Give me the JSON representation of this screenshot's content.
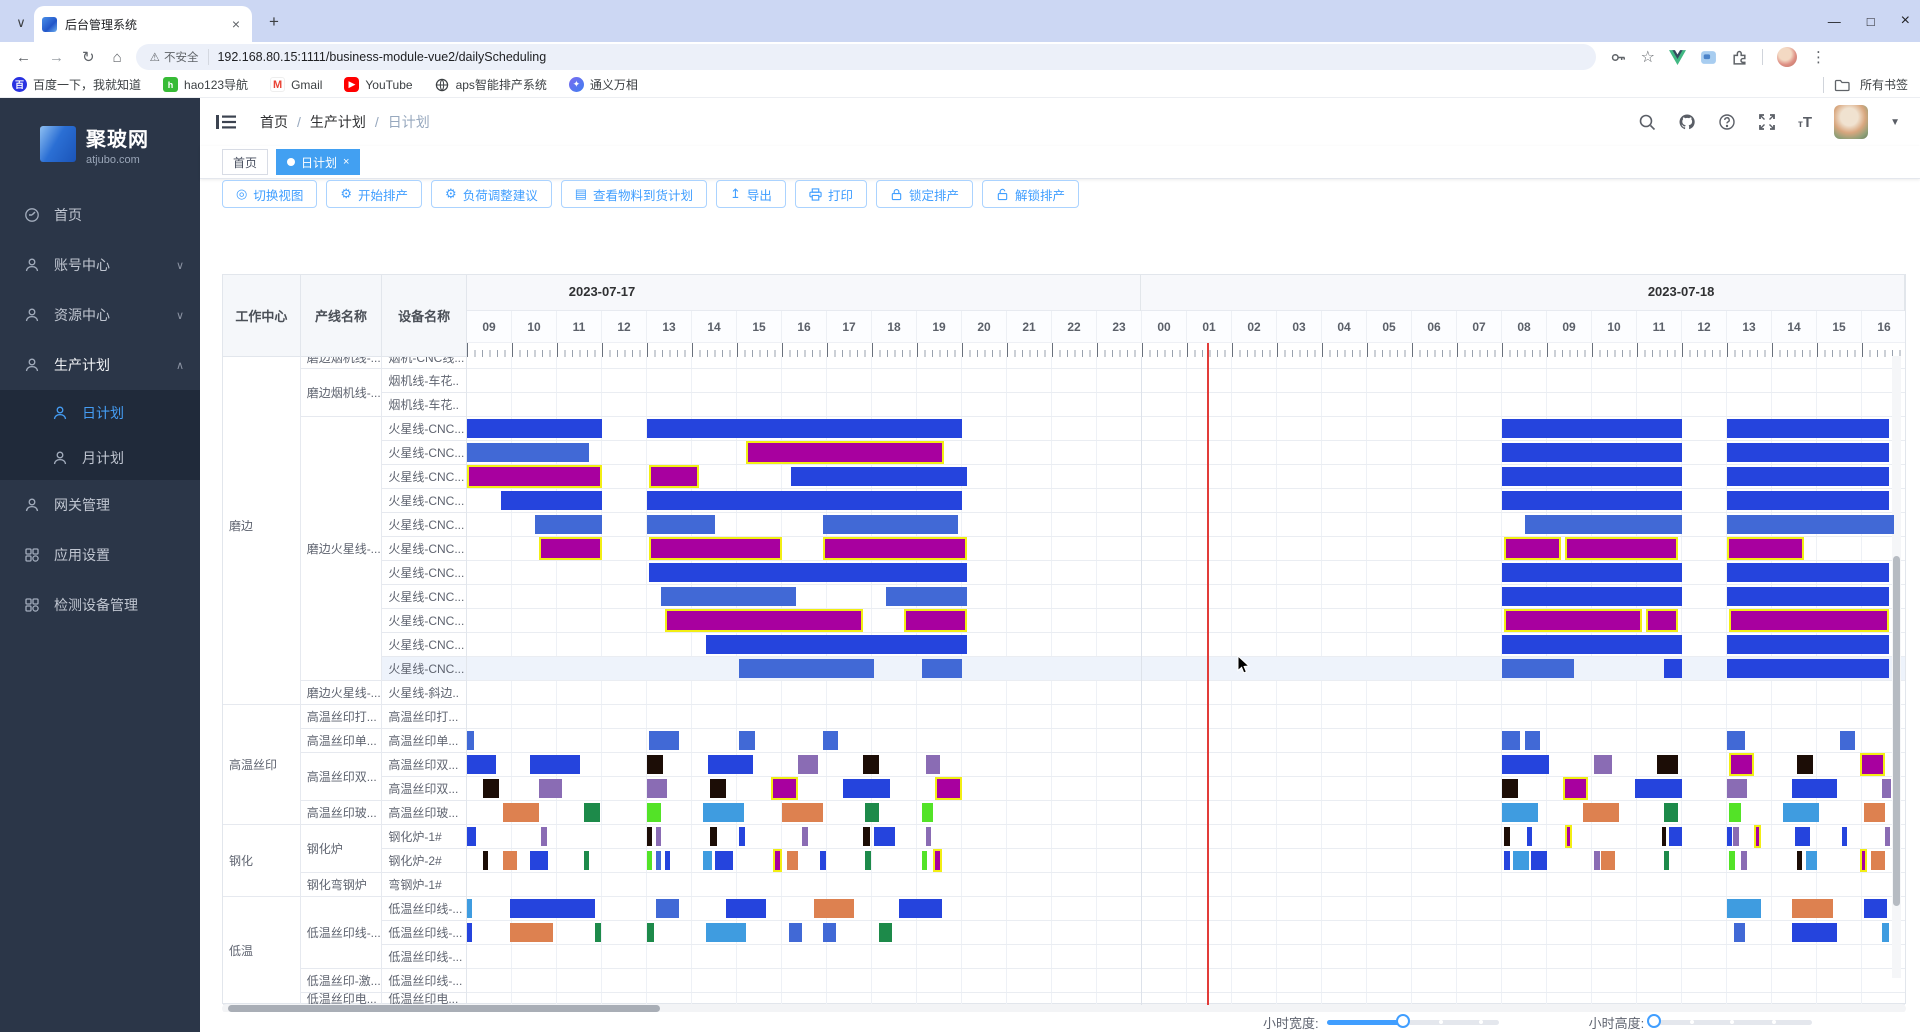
{
  "browser": {
    "tab_title": "后台管理系统",
    "security_label": "不安全",
    "url": "192.168.80.15:1111/business-module-vue2/dailyScheduling",
    "bookmarks": [
      "百度一下，我就知道",
      "hao123导航",
      "Gmail",
      "YouTube",
      "aps智能排产系统",
      "通义万相"
    ],
    "all_bookmarks_label": "所有书签",
    "window_controls": [
      "—",
      "□",
      "×"
    ],
    "new_tab_glyph": "+",
    "tab_close_glyph": "×",
    "tab_search_glyph": "∨",
    "nav_glyphs": {
      "back": "←",
      "forward": "→",
      "reload": "↻",
      "home": "⌂",
      "warning": "⚠"
    }
  },
  "sidebar": {
    "logo_title": "聚玻网",
    "logo_sub": "atjubo.com",
    "items": [
      {
        "label": "首页"
      },
      {
        "label": "账号中心",
        "arrow": "∨"
      },
      {
        "label": "资源中心",
        "arrow": "∨"
      },
      {
        "label": "生产计划",
        "arrow": "∧"
      },
      {
        "label": "日计划"
      },
      {
        "label": "月计划"
      },
      {
        "label": "网关管理"
      },
      {
        "label": "应用设置"
      },
      {
        "label": "检测设备管理"
      }
    ]
  },
  "header": {
    "breadcrumb": [
      "首页",
      "生产计划",
      "日计划"
    ],
    "separator": "/"
  },
  "tags": [
    {
      "label": "首页"
    },
    {
      "label": "日计划",
      "close_glyph": "×"
    }
  ],
  "toolbar": {
    "buttons": [
      "切换视图",
      "开始排产",
      "负荷调整建议",
      "查看物料到货计划",
      "导出",
      "打印",
      "锁定排产",
      "解锁排产"
    ]
  },
  "gantt": {
    "columns": [
      "工作中心",
      "产线名称",
      "设备名称"
    ],
    "dates": [
      "2023-07-17",
      "2023-07-18"
    ],
    "hours_day1": [
      "09",
      "10",
      "11",
      "12",
      "13",
      "14",
      "15",
      "16",
      "17",
      "18",
      "19",
      "20",
      "21",
      "22",
      "23"
    ],
    "hours_day2": [
      "00",
      "01",
      "02",
      "03",
      "04",
      "05",
      "06",
      "07",
      "08",
      "09",
      "10",
      "11",
      "12",
      "13",
      "14",
      "15",
      "16"
    ],
    "now_time_hour_offset": 16.45,
    "work_centers": [
      {
        "label": "磨边",
        "span": 15
      },
      {
        "label": "高温丝印",
        "span": 5
      },
      {
        "label": "钢化",
        "span": 3
      },
      {
        "label": "低温",
        "span": 5
      }
    ],
    "lines": [
      {
        "label": "磨边烟机线-...",
        "span": 1
      },
      {
        "label": "磨边烟机线-...",
        "span": 2
      },
      {
        "label": "磨边火星线-...",
        "span": 11
      },
      {
        "label": "磨边火星线-...",
        "span": 1
      },
      {
        "label": "高温丝印打...",
        "span": 1
      },
      {
        "label": "高温丝印单...",
        "span": 1
      },
      {
        "label": "高温丝印双...",
        "span": 2
      },
      {
        "label": "高温丝印玻...",
        "span": 1
      },
      {
        "label": "钢化炉",
        "span": 2
      },
      {
        "label": "钢化弯钢炉",
        "span": 1
      },
      {
        "label": "低温丝印线-...",
        "span": 3
      },
      {
        "label": "低温丝印-激...",
        "span": 1
      },
      {
        "label": "低温丝印电...",
        "span": 1
      }
    ],
    "rows": [
      {
        "device": "烟机-CNC线...",
        "bars": []
      },
      {
        "device": "烟机线-车花..",
        "bars": []
      },
      {
        "device": "烟机线-车花..",
        "bars": []
      },
      {
        "device": "火星线-CNC...",
        "bars": [
          [
            0,
            3,
            "b"
          ],
          [
            4,
            11,
            "b"
          ],
          [
            23,
            27,
            "b"
          ],
          [
            28,
            31.6,
            "b"
          ]
        ]
      },
      {
        "device": "火星线-CNC...",
        "bars": [
          [
            0,
            2.7,
            "m"
          ],
          [
            6.2,
            10.6,
            "p"
          ],
          [
            23,
            27,
            "b"
          ],
          [
            28,
            31.6,
            "b"
          ]
        ]
      },
      {
        "device": "火星线-CNC...",
        "bars": [
          [
            0,
            3,
            "p"
          ],
          [
            4.05,
            5.15,
            "p"
          ],
          [
            7.2,
            11.1,
            "b"
          ],
          [
            23,
            27,
            "b"
          ],
          [
            28,
            31.6,
            "b"
          ]
        ]
      },
      {
        "device": "火星线-CNC...",
        "bars": [
          [
            0.75,
            3,
            "b"
          ],
          [
            4,
            11,
            "b"
          ],
          [
            23,
            27,
            "b"
          ],
          [
            28,
            31.6,
            "b"
          ]
        ]
      },
      {
        "device": "火星线-CNC...",
        "bars": [
          [
            1.5,
            3,
            "m"
          ],
          [
            4,
            5.5,
            "m"
          ],
          [
            7.9,
            10.9,
            "m"
          ],
          [
            23.5,
            27,
            "m"
          ],
          [
            28,
            31.7,
            "m"
          ]
        ]
      },
      {
        "device": "火星线-CNC...",
        "bars": [
          [
            1.6,
            3,
            "p"
          ],
          [
            4.05,
            7,
            "p"
          ],
          [
            7.9,
            11.1,
            "p"
          ],
          [
            23.05,
            24.3,
            "p"
          ],
          [
            24.4,
            26.9,
            "p"
          ],
          [
            28,
            29.7,
            "p"
          ]
        ]
      },
      {
        "device": "火星线-CNC...",
        "bars": [
          [
            4.05,
            11.1,
            "b"
          ],
          [
            23,
            27,
            "b"
          ],
          [
            28,
            31.6,
            "b"
          ]
        ]
      },
      {
        "device": "火星线-CNC...",
        "bars": [
          [
            4.3,
            7.3,
            "m"
          ],
          [
            9.3,
            11.1,
            "m"
          ],
          [
            23,
            27,
            "b"
          ],
          [
            28,
            31.6,
            "b"
          ]
        ]
      },
      {
        "device": "火星线-CNC...",
        "bars": [
          [
            4.4,
            8.8,
            "p"
          ],
          [
            9.7,
            11.1,
            "p"
          ],
          [
            23.05,
            26.1,
            "p"
          ],
          [
            26.2,
            26.9,
            "p"
          ],
          [
            28.05,
            31.6,
            "p"
          ]
        ]
      },
      {
        "device": "火星线-CNC...",
        "bars": [
          [
            5.3,
            11.1,
            "b"
          ],
          [
            23,
            27,
            "b"
          ],
          [
            28,
            31.6,
            "b"
          ]
        ]
      },
      {
        "device": "火星线-CNC...",
        "highlighted": true,
        "bars": [
          [
            6.05,
            9.05,
            "m"
          ],
          [
            10.1,
            11,
            "m"
          ],
          [
            23,
            24.6,
            "m"
          ],
          [
            26.6,
            27,
            "b"
          ],
          [
            28,
            31.6,
            "b"
          ]
        ]
      },
      {
        "device": "火星线-斜边..",
        "bars": []
      },
      {
        "device": "高温丝印打...",
        "bars": []
      },
      {
        "device": "高温丝印单...",
        "bars": [
          [
            0,
            0.15,
            "m"
          ],
          [
            4.05,
            4.7,
            "m"
          ],
          [
            6.05,
            6.4,
            "m"
          ],
          [
            7.9,
            8.25,
            "m"
          ],
          [
            23,
            23.4,
            "m"
          ],
          [
            23.5,
            23.85,
            "m"
          ],
          [
            28,
            28.4,
            "m"
          ],
          [
            30.5,
            30.85,
            "m"
          ]
        ]
      },
      {
        "device": "高温丝印双...",
        "bars": [
          [
            0,
            0.65,
            "b"
          ],
          [
            1.4,
            2.5,
            "b"
          ],
          [
            4,
            4.35,
            "k"
          ],
          [
            5.35,
            6.35,
            "b"
          ],
          [
            7.35,
            7.8,
            "l"
          ],
          [
            8.8,
            9.15,
            "k"
          ],
          [
            10.2,
            10.5,
            "l"
          ],
          [
            23,
            24.05,
            "b"
          ],
          [
            25.05,
            25.45,
            "l"
          ],
          [
            26.45,
            26.9,
            "k"
          ],
          [
            28.05,
            28.6,
            "p"
          ],
          [
            29.55,
            29.9,
            "k"
          ],
          [
            30.95,
            31.5,
            "p"
          ]
        ]
      },
      {
        "device": "高温丝印双...",
        "bars": [
          [
            0.35,
            0.7,
            "k"
          ],
          [
            1.6,
            2.1,
            "l"
          ],
          [
            4,
            4.45,
            "l"
          ],
          [
            5.4,
            5.75,
            "k"
          ],
          [
            6.75,
            7.35,
            "p"
          ],
          [
            8.35,
            9.4,
            "b"
          ],
          [
            10.4,
            11,
            "p"
          ],
          [
            23,
            23.35,
            "k"
          ],
          [
            24.35,
            24.9,
            "p"
          ],
          [
            25.95,
            27,
            "b"
          ],
          [
            28,
            28.45,
            "l"
          ],
          [
            29.45,
            30.45,
            "b"
          ],
          [
            31.45,
            31.65,
            "l"
          ]
        ]
      },
      {
        "device": "高温丝印玻...",
        "bars": [
          [
            0.8,
            1.6,
            "o"
          ],
          [
            2.6,
            2.95,
            "g"
          ],
          [
            4,
            4.3,
            "e"
          ],
          [
            5.25,
            6.15,
            "s"
          ],
          [
            7,
            7.9,
            "o"
          ],
          [
            8.85,
            9.15,
            "g"
          ],
          [
            10.1,
            10.35,
            "e"
          ],
          [
            23,
            23.8,
            "s"
          ],
          [
            24.8,
            25.6,
            "o"
          ],
          [
            26.6,
            26.9,
            "g"
          ],
          [
            28.05,
            28.3,
            "e"
          ],
          [
            29.25,
            30.05,
            "s"
          ],
          [
            31.05,
            31.5,
            "o"
          ]
        ]
      },
      {
        "device": "钢化炉-1#",
        "bars": [
          [
            0,
            0.2,
            "b"
          ],
          [
            1.65,
            1.78,
            "l"
          ],
          [
            4,
            4.12,
            "k"
          ],
          [
            4.2,
            4.32,
            "l"
          ],
          [
            5.4,
            5.55,
            "k"
          ],
          [
            6.05,
            6.17,
            "b"
          ],
          [
            7.45,
            7.57,
            "l"
          ],
          [
            8.8,
            8.95,
            "k"
          ],
          [
            9.05,
            9.5,
            "b"
          ],
          [
            10.2,
            10.32,
            "l"
          ],
          [
            23.05,
            23.17,
            "k"
          ],
          [
            23.55,
            23.67,
            "b"
          ],
          [
            24.4,
            24.56,
            "p"
          ],
          [
            26.55,
            26.65,
            "k"
          ],
          [
            26.7,
            27,
            "b"
          ],
          [
            28,
            28.1,
            "b"
          ],
          [
            28.13,
            28.26,
            "l"
          ],
          [
            28.6,
            28.76,
            "p"
          ],
          [
            29.5,
            29.85,
            "b"
          ],
          [
            30.55,
            30.67,
            "b"
          ],
          [
            31.5,
            31.62,
            "l"
          ]
        ]
      },
      {
        "device": "钢化炉-2#",
        "bars": [
          [
            0.35,
            0.47,
            "k"
          ],
          [
            0.8,
            1.1,
            "o"
          ],
          [
            1.4,
            1.8,
            "b"
          ],
          [
            2.6,
            2.72,
            "g"
          ],
          [
            4,
            4.1,
            "e"
          ],
          [
            4.2,
            4.32,
            "m"
          ],
          [
            4.4,
            4.52,
            "b"
          ],
          [
            5.25,
            5.45,
            "s"
          ],
          [
            5.5,
            5.9,
            "b"
          ],
          [
            6.8,
            7,
            "p"
          ],
          [
            7.1,
            7.35,
            "o"
          ],
          [
            7.85,
            7.97,
            "b"
          ],
          [
            8.85,
            8.97,
            "g"
          ],
          [
            10.1,
            10.22,
            "e"
          ],
          [
            10.35,
            10.55,
            "p"
          ],
          [
            23.05,
            23.17,
            "b"
          ],
          [
            23.25,
            23.6,
            "s"
          ],
          [
            23.65,
            24,
            "b"
          ],
          [
            25.05,
            25.17,
            "l"
          ],
          [
            25.2,
            25.5,
            "o"
          ],
          [
            26.6,
            26.72,
            "g"
          ],
          [
            28.05,
            28.17,
            "e"
          ],
          [
            28.3,
            28.45,
            "l"
          ],
          [
            29.55,
            29.67,
            "k"
          ],
          [
            29.75,
            30,
            "s"
          ],
          [
            30.95,
            31.1,
            "p"
          ],
          [
            31.2,
            31.5,
            "o"
          ]
        ]
      },
      {
        "device": "弯钢炉-1#",
        "bars": []
      },
      {
        "device": "低温丝印线-...",
        "bars": [
          [
            0,
            0.1,
            "s"
          ],
          [
            0.95,
            2.85,
            "b"
          ],
          [
            4.2,
            4.7,
            "m"
          ],
          [
            5.75,
            6.65,
            "b"
          ],
          [
            7.7,
            8.6,
            "o"
          ],
          [
            9.6,
            10.55,
            "b"
          ],
          [
            28,
            28.75,
            "s"
          ],
          [
            29.45,
            30.35,
            "o"
          ],
          [
            31.05,
            31.55,
            "b"
          ]
        ]
      },
      {
        "device": "低温丝印线-...",
        "bars": [
          [
            0,
            0.1,
            "b"
          ],
          [
            0.95,
            1.9,
            "o"
          ],
          [
            2.85,
            2.97,
            "g"
          ],
          [
            4,
            4.15,
            "g"
          ],
          [
            5.3,
            6.2,
            "s"
          ],
          [
            7.15,
            7.45,
            "m"
          ],
          [
            7.9,
            8.2,
            "m"
          ],
          [
            9.15,
            9.45,
            "g"
          ],
          [
            28.15,
            28.4,
            "m"
          ],
          [
            29.45,
            30.45,
            "b"
          ],
          [
            31.45,
            31.6,
            "s"
          ]
        ]
      },
      {
        "device": "低温丝印线-...",
        "bars": []
      },
      {
        "device": "低温丝印线-...",
        "bars": []
      },
      {
        "device": "低温丝印电...",
        "bars": []
      }
    ],
    "slider_width_label": "小时宽度:",
    "slider_height_label": "小时高度:",
    "slider_width_percent": 44,
    "slider_height_percent": 0
  },
  "colors": {
    "b": "#2544dd",
    "m": "#4169d6",
    "p": "#a8009f",
    "k": "#1c0d06",
    "l": "#8a6cb4",
    "o": "#dd8150",
    "g": "#1d8a4a",
    "e": "#53e327",
    "s": "#3f9ce0",
    "bar_outline": "#f2ee14",
    "now_line": "#e23c39",
    "accent": "#409eff",
    "tag_active": "#42a0f2",
    "sidebar_bg": "#2b3648"
  }
}
